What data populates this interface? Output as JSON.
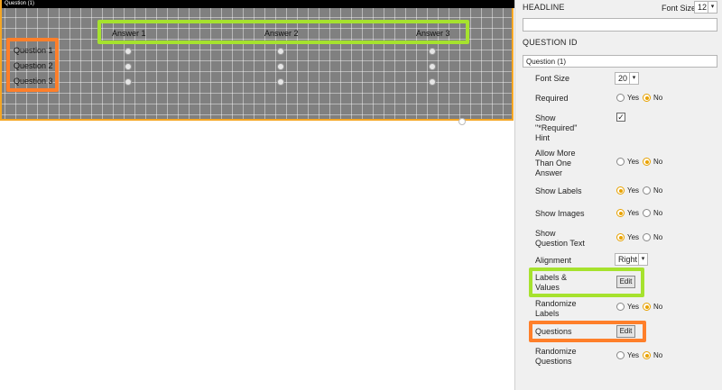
{
  "canvas": {
    "title": "Question (1)",
    "answers": [
      "Answer 1",
      "Answer 2",
      "Answer 3"
    ],
    "questions": [
      "Question 1",
      "Question 2",
      "Question 3"
    ]
  },
  "panel": {
    "headline_label": "HEADLINE",
    "headline_value": "",
    "font_size_label": "Font Size",
    "font_size_value": "12",
    "question_id_label": "QUESTION ID",
    "question_id_value": "Question (1)",
    "props": {
      "font_size_label": "Font Size",
      "font_size_value": "20",
      "required_label": "Required",
      "show_required_hint_label": "Show \"*Required\" Hint",
      "show_required_hint_checked": true,
      "allow_more_label": "Allow More Than One Answer",
      "show_labels_label": "Show Labels",
      "show_images_label": "Show Images",
      "show_question_text_label": "Show Question Text",
      "alignment_label": "Alignment",
      "alignment_value": "Right",
      "labels_values_label": "Labels & Values",
      "edit_label": "Edit",
      "randomize_labels_label": "Randomize Labels",
      "questions_label": "Questions",
      "randomize_questions_label": "Randomize Questions",
      "yes": "Yes",
      "no": "No"
    }
  },
  "selections": {
    "required": "no",
    "allow_more": "no",
    "show_labels": "yes",
    "show_images": "yes",
    "show_question_text": "yes",
    "randomize_labels": "no",
    "randomize_questions": "no"
  },
  "colors": {
    "highlight_green": "#a6e22e",
    "highlight_orange": "#ff7f2a",
    "radio_selected": "#e8a200",
    "canvas_border": "#f5a623"
  }
}
